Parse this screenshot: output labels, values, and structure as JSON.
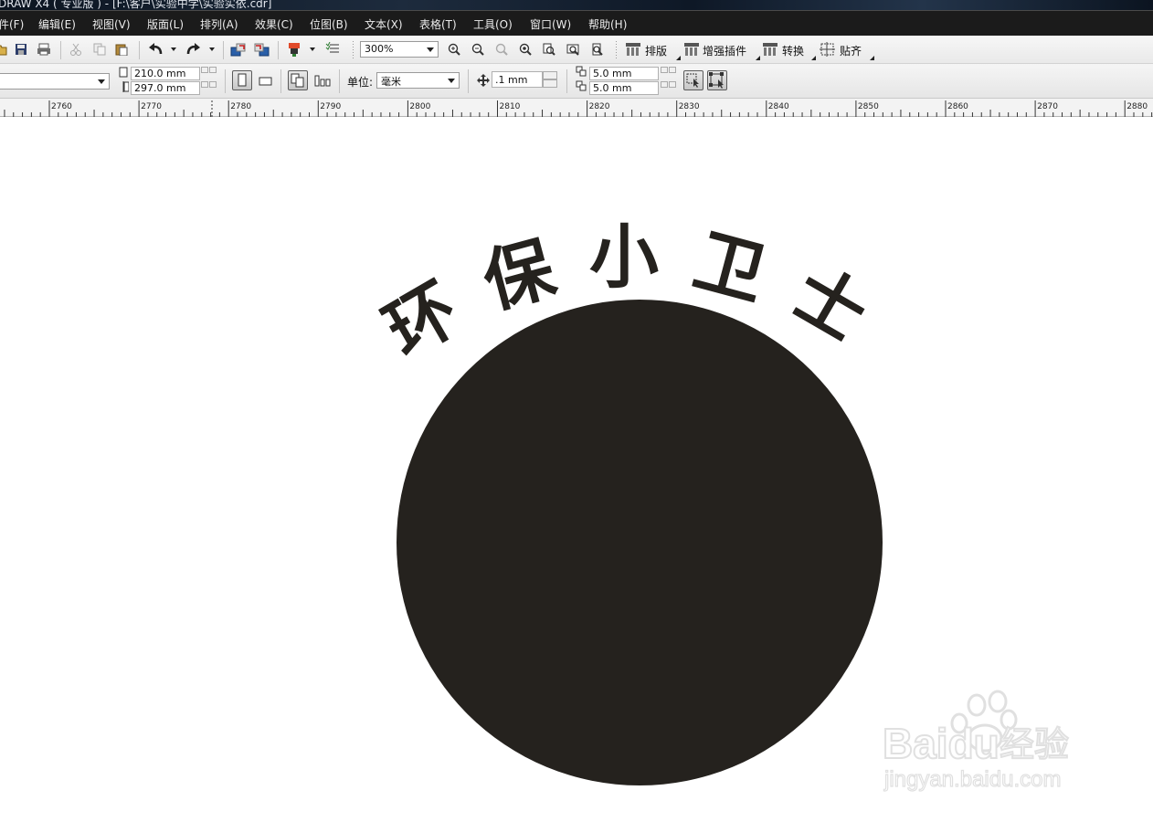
{
  "window": {
    "title": "DRAW X4 ( 专业版 ) - [F:\\客户\\实验中学\\实验实依.cdr]"
  },
  "menu": {
    "items": [
      "件(F)",
      "编辑(E)",
      "视图(V)",
      "版面(L)",
      "排列(A)",
      "效果(C)",
      "位图(B)",
      "文本(X)",
      "表格(T)",
      "工具(O)",
      "窗口(W)",
      "帮助(H)"
    ]
  },
  "toolbar": {
    "zoom": "300%",
    "buttons": {
      "layout": "排版",
      "plugins": "增强插件",
      "convert": "转换",
      "snap": "贴齐"
    }
  },
  "property_bar": {
    "page_width": "210.0 mm",
    "page_height": "297.0 mm",
    "unit_label": "单位:",
    "unit_value": "毫米",
    "nudge": ".1 mm",
    "dup_x": "5.0 mm",
    "dup_y": "5.0 mm"
  },
  "ruler": {
    "labels": [
      "2760",
      "2770",
      "2780",
      "2790",
      "2800",
      "2810",
      "2820",
      "2830",
      "2840",
      "2850",
      "2860",
      "2870",
      "2880"
    ]
  },
  "artwork": {
    "arc_text": [
      "环",
      "保",
      "小",
      "卫",
      "士"
    ],
    "circle_color": "#25221e",
    "text_color": "#25221e"
  },
  "watermark": {
    "brand": "Baidu",
    "brand_cn": "经验",
    "url": "jingyan.baidu.com"
  }
}
